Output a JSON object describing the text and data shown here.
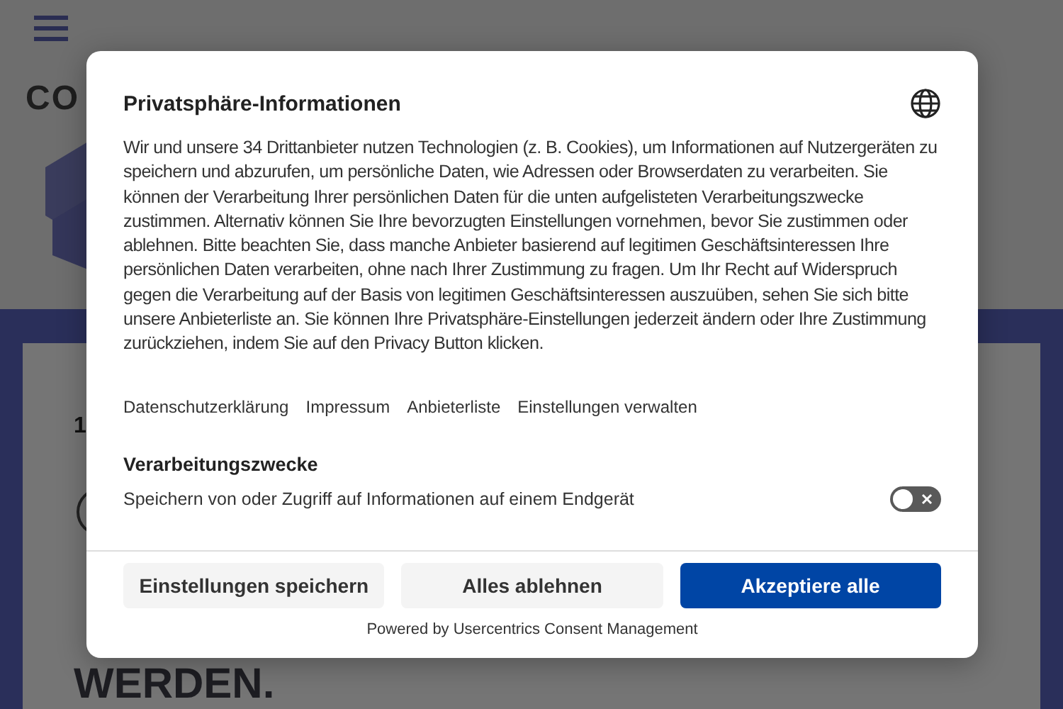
{
  "page": {
    "logo_text": "CO",
    "date_text": "1",
    "headline": "WERDEN."
  },
  "dialog": {
    "title": "Privatsphäre-Informationen",
    "body": "Wir und unsere 34 Drittanbieter nutzen Technologien (z. B. Cookies), um Informationen auf Nutzergeräten zu speichern und abzurufen, um persönliche Daten, wie Adressen oder Browserdaten zu verarbeiten. Sie können der Verarbeitung Ihrer persönlichen Daten für die unten aufgelisteten Verarbeitungszwecke zustimmen. Alternativ können Sie Ihre bevorzugten Einstellungen vornehmen, bevor Sie zustimmen oder ablehnen. Bitte beachten Sie, dass manche Anbieter basierend auf legitimen Geschäftsinteressen Ihre persönlichen Daten verarbeiten, ohne nach Ihrer Zustimmung zu fragen. Um Ihr Recht auf Widerspruch gegen die Verarbeitung auf der Basis von legitimen Geschäftsinteressen auszuüben, sehen Sie sich bitte unsere Anbieterliste an. Sie können Ihre Privatsphäre-Einstellungen jederzeit ändern oder Ihre Zustimmung zurückziehen, indem Sie auf den Privacy Button klicken.",
    "links": [
      "Datenschutzerklärung",
      "Impressum",
      "Anbieterliste",
      "Einstellungen verwalten"
    ],
    "section_title": "Verarbeitungszwecke",
    "purposes": [
      {
        "label": "Speichern von oder Zugriff auf Informationen auf einem Endgerät",
        "on": false
      }
    ],
    "buttons": [
      {
        "label": "Einstellungen speichern",
        "kind": "secondary"
      },
      {
        "label": "Alles ablehnen",
        "kind": "secondary"
      },
      {
        "label": "Akzeptiere alle",
        "kind": "primary"
      }
    ],
    "powered_by": "Powered by Usercentrics Consent Management"
  }
}
